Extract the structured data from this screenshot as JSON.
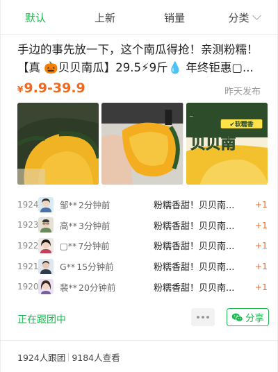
{
  "tabs": [
    {
      "label": "默认",
      "active": true
    },
    {
      "label": "上新",
      "active": false
    },
    {
      "label": "销量",
      "active": false
    },
    {
      "label": "分类",
      "active": false,
      "icon": "chevron-down-icon"
    }
  ],
  "product": {
    "title": "手边的事先放一下，这个南瓜得抢！亲测粉糯！【真 🎃贝贝南瓜】29.5⚡9斤💧 年终钜惠▢...",
    "price_currency": "¥",
    "price_range": "9.9-39.9",
    "posted": "昨天发布",
    "images": [
      {
        "name": "pumpkin-whole-photo"
      },
      {
        "name": "pumpkin-hand-photo"
      },
      {
        "name": "pumpkin-promo-photo",
        "badge": "✔软糯香",
        "big_text": "贝贝南"
      }
    ]
  },
  "orders": [
    {
      "num": "1924",
      "user": "邹**",
      "time": "2分钟前",
      "text": "粉糯香甜！贝贝南...",
      "plus": "+1",
      "avatar": "avatar-woman-dark-hair"
    },
    {
      "num": "1923",
      "user": "高**",
      "time": "3分钟前",
      "text": "粉糯香甜！贝贝南...",
      "plus": "+1",
      "avatar": "avatar-man-glasses"
    },
    {
      "num": "1922",
      "user": "▢**",
      "time": "7分钟前",
      "text": "粉糯香甜！贝贝南...",
      "plus": "+1",
      "avatar": "avatar-woman-black-hair"
    },
    {
      "num": "1921",
      "user": "G**",
      "time": "15分钟前",
      "text": "粉糯香甜！贝贝南...",
      "plus": "+1",
      "avatar": "avatar-man-dark"
    },
    {
      "num": "1920",
      "user": "裴**",
      "time": "20分钟前",
      "text": "粉糯香甜！贝贝南...",
      "plus": "+1",
      "avatar": "avatar-woman-long-hair"
    }
  ],
  "status": {
    "following_label": "正在跟团中",
    "share_label": "分享",
    "share_icon": "wechat-icon",
    "more_icon": "more-dots-icon"
  },
  "footer": {
    "followers": "1924人跟团",
    "views": "9184人查看"
  },
  "colors": {
    "accent_green": "#1db953",
    "price_orange": "#ef6a1e"
  }
}
